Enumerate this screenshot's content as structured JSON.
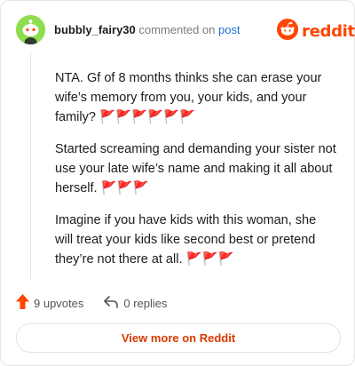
{
  "comment": {
    "author": "bubbly_fairy30",
    "action_text": "commented on",
    "post_link": "post",
    "paragraphs": [
      "NTA. Gf of 8 months thinks she can erase your wife’s memory from you, your kids, and your family? 🚩🚩🚩🚩🚩🚩",
      "Started screaming and demanding your sister not use your late wife’s name and making it all about herself. 🚩🚩🚩",
      "Imagine if you have kids with this woman, she will treat your kids like second best or pretend they’re not there at all. 🚩🚩🚩"
    ]
  },
  "brand": {
    "name": "reddit",
    "color": "#ff4500"
  },
  "stats": {
    "upvotes": "9 upvotes",
    "replies": "0 replies"
  },
  "actions": {
    "view_more": "View more on Reddit"
  },
  "icons": {
    "avatar": "snoo-avatar-icon",
    "logo": "reddit-logo-icon",
    "upvote": "upvote-arrow-icon",
    "reply": "reply-arrow-icon"
  },
  "colors": {
    "avatar_bg": "#8fdd4e",
    "upvote": "#ff4500",
    "link": "#1a6fd6",
    "view_more": "#d93a00"
  }
}
